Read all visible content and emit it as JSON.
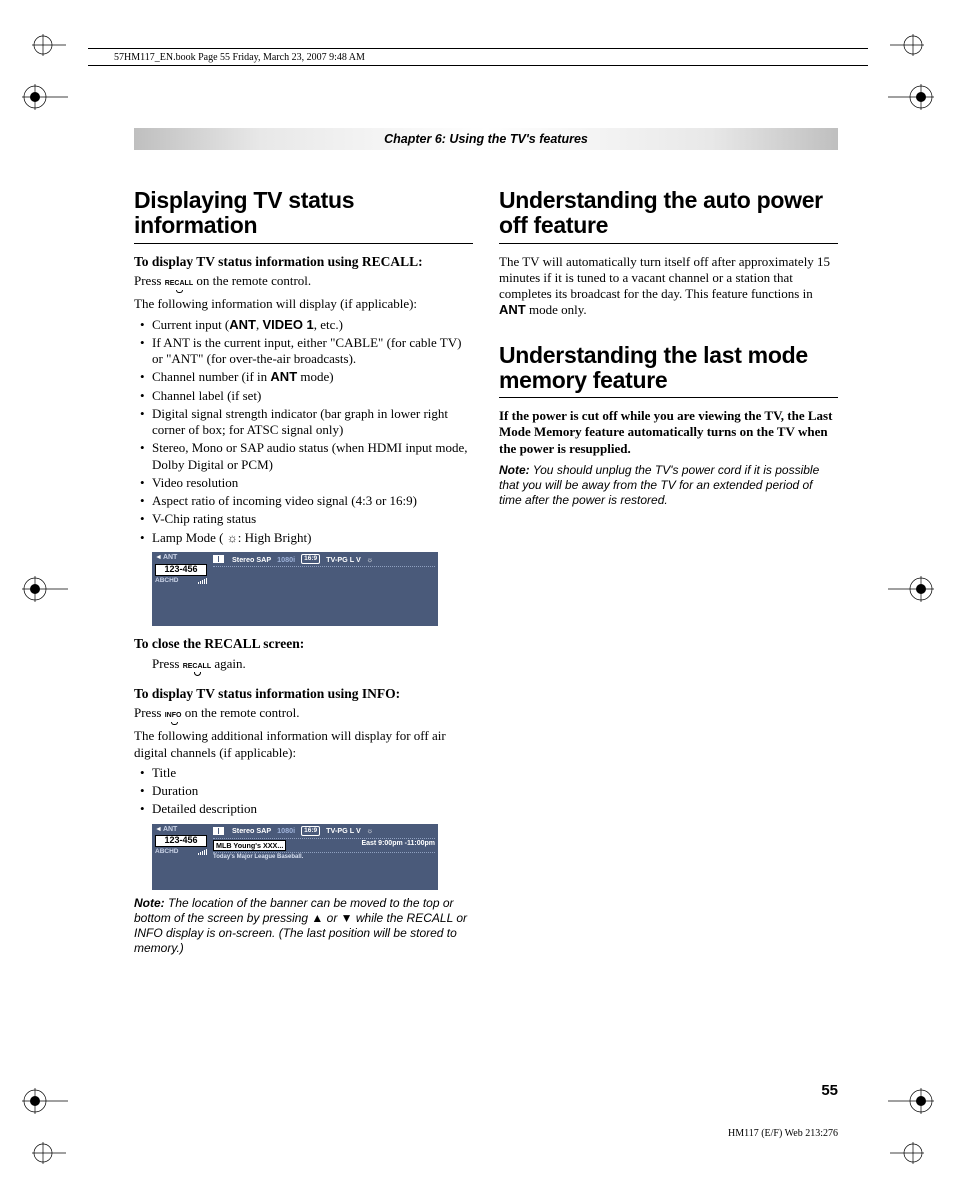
{
  "running_head": "57HM117_EN.book  Page 55  Friday, March 23, 2007  9:48 AM",
  "chapter_bar": "Chapter 6: Using the TV's features",
  "left": {
    "h1": "Displaying TV status information",
    "sub1": "To display TV status information using RECALL:",
    "press_recall_pre": "Press ",
    "press_recall_btn": "RECALL",
    "press_recall_post": " on the remote control.",
    "following": "The following information will display (if applicable):",
    "bullets": {
      "b0a": "Current input (",
      "b0b": "ANT",
      "b0c": ", ",
      "b0d": "VIDEO 1",
      "b0e": ", etc.)",
      "b1": "If ANT is the current input, either \"CABLE\" (for cable TV) or \"ANT\" (for over-the-air broadcasts).",
      "b2a": "Channel number (if in ",
      "b2b": "ANT",
      "b2c": " mode)",
      "b3": "Channel label (if set)",
      "b4": "Digital signal strength indicator (bar graph in lower right corner of box; for ATSC signal only)",
      "b5": "Stereo, Mono or SAP audio status (when HDMI input mode, Dolby Digital or PCM)",
      "b6": "Video resolution",
      "b7": "Aspect ratio of incoming video signal (4:3 or 16:9)",
      "b8": "V-Chip rating status",
      "b9a": "Lamp Mode ( ",
      "b9b": ": High Bright)"
    },
    "osd1": {
      "ant": "ANT",
      "chan": "123-456",
      "label": "ABCHD",
      "stereo": "Stereo SAP",
      "res": "1080i",
      "aspect": "16:9",
      "rating": "TV-PG  L  V"
    },
    "sub2": "To close the RECALL screen:",
    "press_again_pre": "Press ",
    "press_again_btn": "RECALL",
    "press_again_post": " again.",
    "sub3": "To display TV status information using INFO:",
    "press_info_pre": "Press ",
    "press_info_btn": "INFO",
    "press_info_post": " on the remote control.",
    "following2": "The following additional information will display for off air digital channels (if applicable):",
    "bullets2": {
      "b0": "Title",
      "b1": "Duration",
      "b2": "Detailed description"
    },
    "osd2": {
      "ant": "ANT",
      "chan": "123-456",
      "label": "ABCHD",
      "stereo": "Stereo SAP",
      "res": "1080i",
      "aspect": "16:9",
      "rating": "TV-PG  L  V",
      "title": "MLB Young's XXX...",
      "time": "East 9:00pm -11:00pm",
      "desc": "Today's Major League Baseball."
    },
    "note_label": "Note:",
    "note": " The location of the banner can be moved to the top or bottom of the screen by pressing ▲ or ▼ while the RECALL or INFO display is on-screen. (The last position will be stored to memory.)"
  },
  "right": {
    "h1a": "Understanding the auto power off feature",
    "p1a": "The TV will automatically turn itself off after approximately 15 minutes if it is tuned to a vacant channel or a station that completes its broadcast for the day. This feature functions in ",
    "p1b": "ANT",
    "p1c": " mode only.",
    "h1b": "Understanding the last mode memory feature",
    "p2": "If the power is cut off while you are viewing the TV, the Last Mode Memory feature automatically turns on the TV when the power is resupplied.",
    "note_label": "Note:",
    "note": " You should unplug the TV's power cord if it is possible that you will be away from the TV for an extended period of time after the power is restored."
  },
  "page_num": "55",
  "footer_r": "HM117 (E/F) Web 213:276"
}
